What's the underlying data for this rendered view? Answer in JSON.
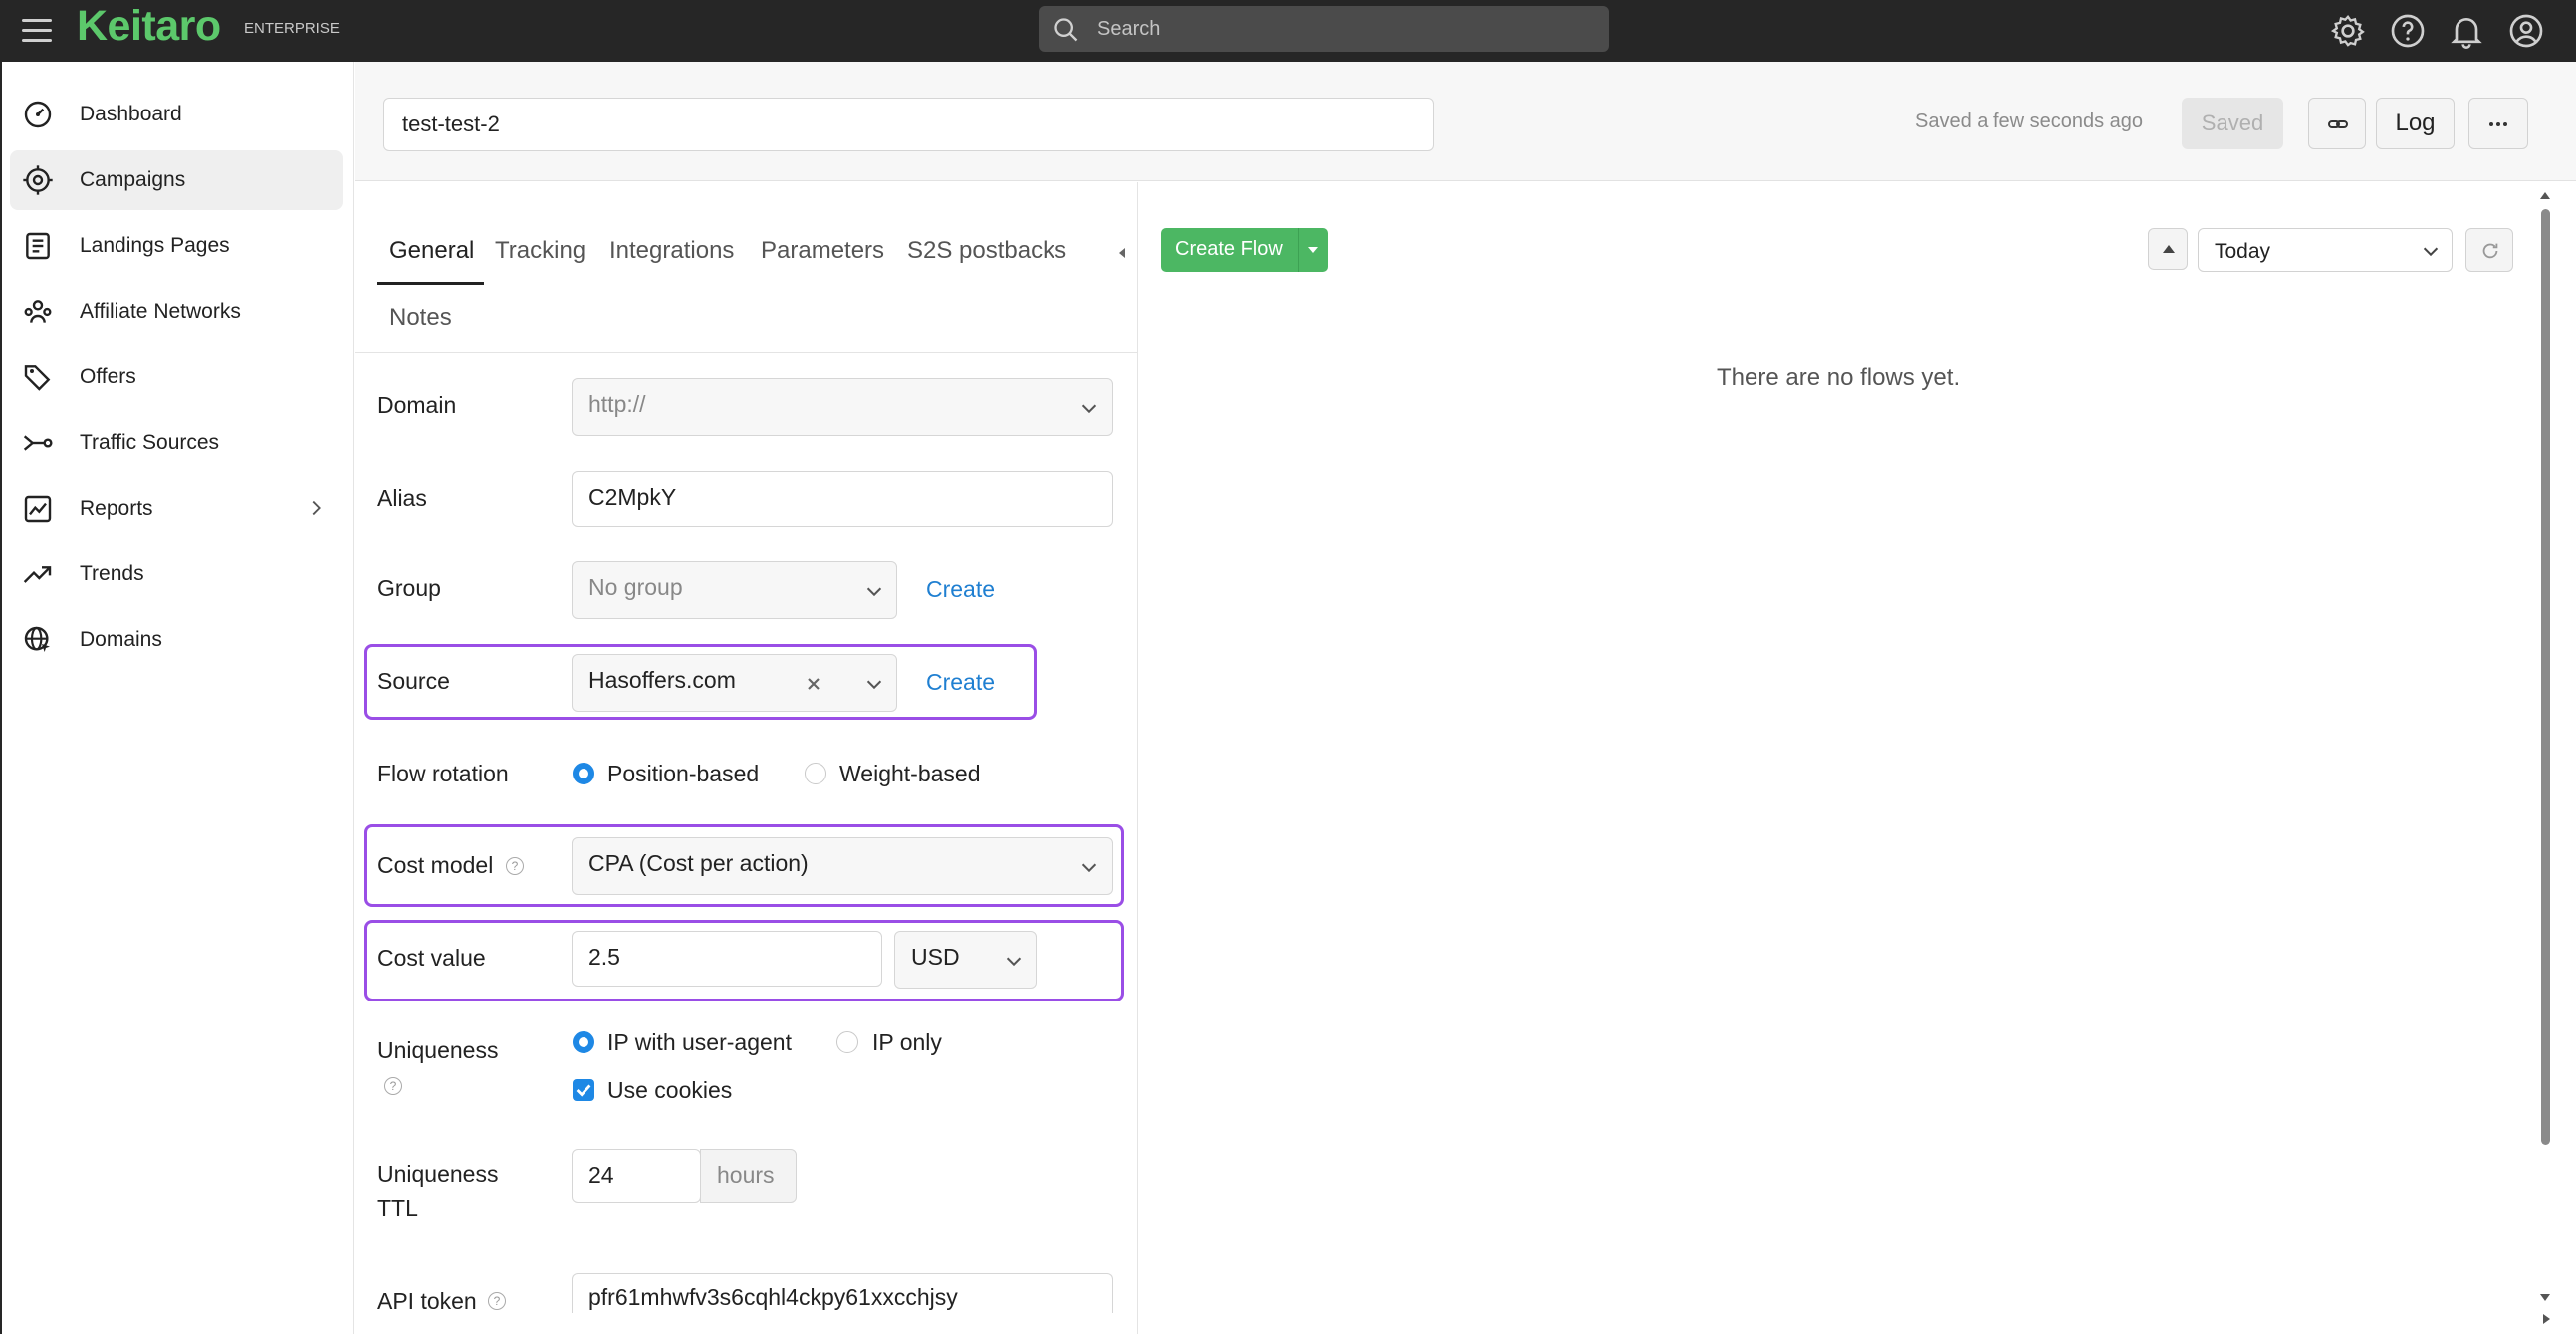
{
  "topbar": {
    "logo": "Keitaro",
    "edition": "ENTERPRISE",
    "search_placeholder": "Search",
    "icons": [
      "settings-icon",
      "help-icon",
      "bell-icon",
      "account-icon"
    ]
  },
  "sidebar": {
    "items": [
      {
        "label": "Dashboard",
        "icon": "dashboard-icon"
      },
      {
        "label": "Campaigns",
        "icon": "target-icon",
        "active": true
      },
      {
        "label": "Landings Pages",
        "icon": "page-icon"
      },
      {
        "label": "Affiliate Networks",
        "icon": "network-icon"
      },
      {
        "label": "Offers",
        "icon": "tag-icon"
      },
      {
        "label": "Traffic Sources",
        "icon": "traffic-icon"
      },
      {
        "label": "Reports",
        "icon": "chart-icon",
        "has_submenu": true
      },
      {
        "label": "Trends",
        "icon": "trend-icon"
      },
      {
        "label": "Domains",
        "icon": "globe-icon"
      }
    ]
  },
  "header": {
    "campaign_name": "test-test-2",
    "save_status": "Saved a few seconds ago",
    "saved_button": "Saved",
    "log_button": "Log"
  },
  "tabs": [
    "General",
    "Tracking",
    "Integrations",
    "Parameters",
    "S2S postbacks",
    "Notes"
  ],
  "form": {
    "domain": {
      "label": "Domain",
      "value": "http://"
    },
    "alias": {
      "label": "Alias",
      "value": "C2MpkY"
    },
    "group": {
      "label": "Group",
      "value": "No group",
      "create": "Create"
    },
    "source": {
      "label": "Source",
      "value": "Hasoffers.com",
      "create": "Create"
    },
    "flow_rotation": {
      "label": "Flow rotation",
      "options": [
        "Position-based",
        "Weight-based"
      ],
      "selected": "Position-based"
    },
    "cost_model": {
      "label": "Cost model",
      "value": "CPA (Cost per action)"
    },
    "cost_value": {
      "label": "Cost value",
      "value": "2.5",
      "currency": "USD"
    },
    "uniqueness": {
      "label": "Uniqueness",
      "options": [
        "IP with user-agent",
        "IP only"
      ],
      "selected": "IP with user-agent",
      "cookies_label": "Use cookies",
      "cookies_checked": true
    },
    "uniqueness_ttl": {
      "label_line1": "Uniqueness",
      "label_line2": "TTL",
      "value": "24",
      "unit": "hours"
    },
    "api_token": {
      "label": "API token",
      "value": "pfr61mhwfv3s6cqhl4ckpy61xxcchjsy"
    }
  },
  "flows": {
    "create_button": "Create Flow",
    "period": "Today",
    "empty_text": "There are no flows yet."
  },
  "colors": {
    "accent_green": "#5cc86b",
    "button_green": "#4cb763",
    "link_blue": "#1f7fd1",
    "highlight_purple": "#9a4ee6",
    "radio_blue": "#1e88e5"
  }
}
